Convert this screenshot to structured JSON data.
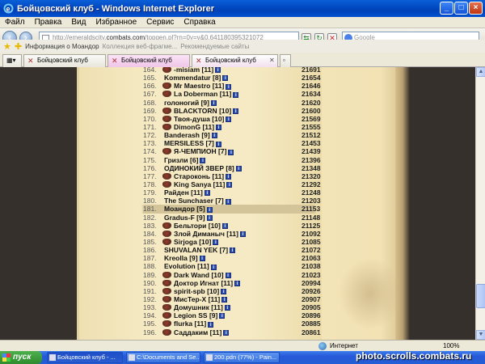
{
  "window": {
    "title": "Бойцовский клуб - Windows Internet Explorer"
  },
  "menu": [
    "Файл",
    "Правка",
    "Вид",
    "Избранное",
    "Сервис",
    "Справка"
  ],
  "address": {
    "pre": "http://emeraldscity.",
    "domain": "combats.com",
    "post": "/topgen.pl?rn=0y=v&0.641180395321072"
  },
  "search": {
    "placeholder": "Google"
  },
  "favorites": {
    "item1": "Информация о Моандор",
    "item2": "Коллекция веб-фрагме...",
    "item3": "Рекомендуемые сайты"
  },
  "tabs": [
    "Бойцовский клуб",
    "Бойцовский клуб",
    "Бойцовский клуб"
  ],
  "rows": [
    {
      "rank": "164.",
      "name": "-misiam",
      "lvl": "[11]",
      "score": "21691",
      "emb": true
    },
    {
      "rank": "165.",
      "name": "Kommendatur",
      "lvl": "[8]",
      "score": "21654",
      "emb": false
    },
    {
      "rank": "166.",
      "name": "Mr Maestro",
      "lvl": "[11]",
      "score": "21646",
      "emb": true
    },
    {
      "rank": "167.",
      "name": "La Doberman",
      "lvl": "[11]",
      "score": "21634",
      "emb": true
    },
    {
      "rank": "168.",
      "name": "голоногий",
      "lvl": "[9]",
      "score": "21620",
      "emb": false
    },
    {
      "rank": "169.",
      "name": "BLACKTORN",
      "lvl": "[10]",
      "score": "21600",
      "emb": true
    },
    {
      "rank": "170.",
      "name": "Твоя-душа",
      "lvl": "[10]",
      "score": "21569",
      "emb": true
    },
    {
      "rank": "171.",
      "name": "DimonG",
      "lvl": "[11]",
      "score": "21555",
      "emb": true
    },
    {
      "rank": "172.",
      "name": "Banderash",
      "lvl": "[9]",
      "score": "21512",
      "emb": false
    },
    {
      "rank": "173.",
      "name": "MERSILESS",
      "lvl": "[7]",
      "score": "21453",
      "emb": false
    },
    {
      "rank": "174.",
      "name": "Я-ЧЕМПИОН",
      "lvl": "[7]",
      "score": "21439",
      "emb": true
    },
    {
      "rank": "175.",
      "name": "Гризли",
      "lvl": "[6]",
      "score": "21396",
      "emb": false
    },
    {
      "rank": "176.",
      "name": "ОДИНОКИЙ ЗВЕР",
      "lvl": "[8]",
      "score": "21348",
      "emb": false
    },
    {
      "rank": "177.",
      "name": "Староконь",
      "lvl": "[11]",
      "score": "21320",
      "emb": true
    },
    {
      "rank": "178.",
      "name": "King Sanya",
      "lvl": "[11]",
      "score": "21292",
      "emb": true
    },
    {
      "rank": "179.",
      "name": "Райден",
      "lvl": "[11]",
      "score": "21248",
      "emb": false
    },
    {
      "rank": "180.",
      "name": "The Sunchaser",
      "lvl": "[7]",
      "score": "21203",
      "emb": false
    },
    {
      "rank": "181.",
      "name": "Моандор",
      "lvl": "[5]",
      "score": "21153",
      "emb": false,
      "hl": true
    },
    {
      "rank": "182.",
      "name": "Gradus-F",
      "lvl": "[9]",
      "score": "21148",
      "emb": false
    },
    {
      "rank": "183.",
      "name": "Бельтори",
      "lvl": "[10]",
      "score": "21125",
      "emb": true
    },
    {
      "rank": "184.",
      "name": "Злой Диманыч",
      "lvl": "[11]",
      "score": "21092",
      "emb": true
    },
    {
      "rank": "185.",
      "name": "Sirjoga",
      "lvl": "[10]",
      "score": "21085",
      "emb": true
    },
    {
      "rank": "186.",
      "name": "SHUVALAN YEK",
      "lvl": "[7]",
      "score": "21072",
      "emb": false
    },
    {
      "rank": "187.",
      "name": "Kreolla",
      "lvl": "[9]",
      "score": "21063",
      "emb": false
    },
    {
      "rank": "188.",
      "name": "Evolution",
      "lvl": "[11]",
      "score": "21038",
      "emb": false
    },
    {
      "rank": "189.",
      "name": "Dark Wand",
      "lvl": "[10]",
      "score": "21023",
      "emb": true
    },
    {
      "rank": "190.",
      "name": "Доктор Игнат",
      "lvl": "[11]",
      "score": "20994",
      "emb": true
    },
    {
      "rank": "191.",
      "name": "spirit-spb",
      "lvl": "[10]",
      "score": "20926",
      "emb": true
    },
    {
      "rank": "192.",
      "name": "МисТер-X",
      "lvl": "[11]",
      "score": "20907",
      "emb": true
    },
    {
      "rank": "193.",
      "name": "Домушник",
      "lvl": "[11]",
      "score": "20905",
      "emb": true
    },
    {
      "rank": "194.",
      "name": "Legion SS",
      "lvl": "[9]",
      "score": "20896",
      "emb": true
    },
    {
      "rank": "195.",
      "name": "flurka",
      "lvl": "[11]",
      "score": "20885",
      "emb": true
    },
    {
      "rank": "196.",
      "name": "Саддаким",
      "lvl": "[11]",
      "score": "20861",
      "emb": true
    }
  ],
  "status": {
    "zone": "Интернет",
    "zoom": "100%"
  },
  "taskbar": {
    "start": "пуск",
    "t1": "Бойцовский клуб - ...",
    "t2": "C:\\Documents and Se...",
    "t3": "200.pdn (77%) - Pain..."
  },
  "watermark": "photo.scrolls.combats.ru",
  "colors": {
    "highlight": "#d3c49a",
    "parchment": "#f6eac4",
    "background": "#35302b"
  }
}
